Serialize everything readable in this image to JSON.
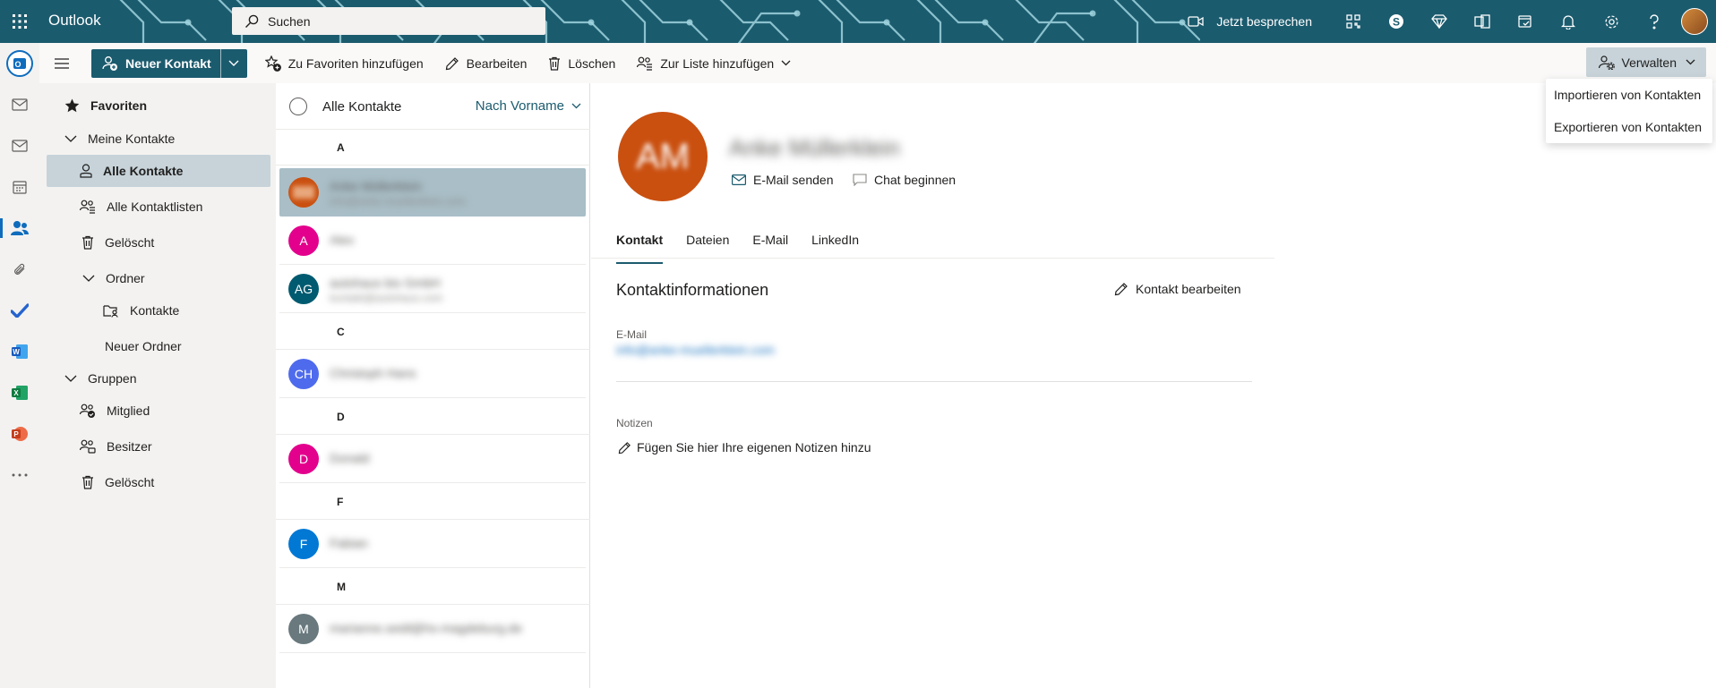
{
  "header": {
    "brand": "Outlook",
    "search_placeholder": "Suchen",
    "meet_now": "Jetzt besprechen"
  },
  "commandbar": {
    "new_contact": "Neuer Kontakt",
    "add_favorites": "Zu Favoriten hinzufügen",
    "edit": "Bearbeiten",
    "delete": "Löschen",
    "add_to_list": "Zur Liste hinzufügen",
    "manage": "Verwalten"
  },
  "manage_menu": {
    "items": [
      "Importieren von Kontakten",
      "Exportieren von Kontakten"
    ]
  },
  "folders": {
    "favorites": "Favoriten",
    "my_contacts": "Meine Kontakte",
    "all_contacts": "Alle Kontakte",
    "all_contact_lists": "Alle Kontaktlisten",
    "deleted": "Gelöscht",
    "folder": "Ordner",
    "contacts": "Kontakte",
    "new_folder": "Neuer Ordner",
    "groups": "Gruppen",
    "member": "Mitglied",
    "owner": "Besitzer",
    "groups_deleted": "Gelöscht"
  },
  "list": {
    "title": "Alle Kontakte",
    "sort": "Nach Vorname",
    "sections": [
      {
        "letter": "A",
        "contacts": [
          {
            "initials": "",
            "color": "#ca5010",
            "name": "Anke Müllerklein",
            "email": "info@anke-muellerklein.com"
          },
          {
            "initials": "A",
            "color": "#e3008c",
            "name": "Alex",
            "email": ""
          },
          {
            "initials": "AG",
            "color": "#005b70",
            "name": "autohaus bis GmbH",
            "email": "kontakt@autohaus.com"
          }
        ]
      },
      {
        "letter": "C",
        "contacts": [
          {
            "initials": "CH",
            "color": "#4f6bed",
            "name": "Christoph Hans",
            "email": ""
          }
        ]
      },
      {
        "letter": "D",
        "contacts": [
          {
            "initials": "D",
            "color": "#e3008c",
            "name": "Donald",
            "email": ""
          }
        ]
      },
      {
        "letter": "F",
        "contacts": [
          {
            "initials": "F",
            "color": "#0078d4",
            "name": "Fabian",
            "email": ""
          }
        ]
      },
      {
        "letter": "M",
        "contacts": [
          {
            "initials": "M",
            "color": "#69797e",
            "name": "marianne.seidl@hs-magdeburg.de",
            "email": ""
          }
        ]
      }
    ]
  },
  "detail": {
    "initials": "AM",
    "name": "Anke Müllerklein",
    "send_email": "E-Mail senden",
    "start_chat": "Chat beginnen",
    "tabs": [
      "Kontakt",
      "Dateien",
      "E-Mail",
      "LinkedIn"
    ],
    "section_title": "Kontaktinformationen",
    "edit_contact": "Kontakt bearbeiten",
    "email_label": "E-Mail",
    "email_value": "info@anke-muellerklein.com",
    "notes_label": "Notizen",
    "notes_placeholder": "Fügen Sie hier Ihre eigenen Notizen hinzu"
  },
  "colors": {
    "header": "#1b5b6e",
    "selection": "#c7d3d9",
    "accent": "#0f6cbd"
  }
}
